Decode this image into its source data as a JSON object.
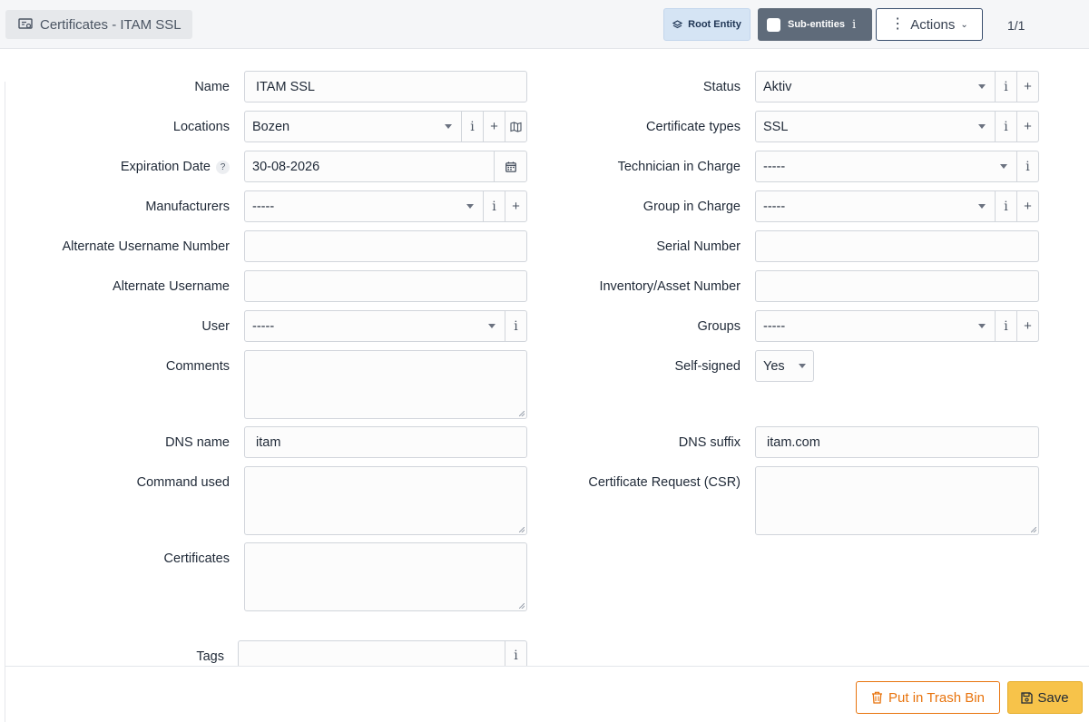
{
  "header": {
    "title": "Certificates - ITAM SSL",
    "root_entity_label": "Root Entity",
    "sub_entities_label": "Sub-entities",
    "actions_label": "Actions",
    "pager": "1/1"
  },
  "form": {
    "name": {
      "label": "Name",
      "value": "ITAM SSL"
    },
    "locations": {
      "label": "Locations",
      "value": "Bozen"
    },
    "expiration_date": {
      "label": "Expiration Date",
      "value": "30-08-2026",
      "help": "?"
    },
    "manufacturers": {
      "label": "Manufacturers",
      "value": "-----"
    },
    "alt_username_number": {
      "label": "Alternate Username Number",
      "value": ""
    },
    "alt_username": {
      "label": "Alternate Username",
      "value": ""
    },
    "user": {
      "label": "User",
      "value": "-----"
    },
    "comments": {
      "label": "Comments",
      "value": ""
    },
    "dns_name": {
      "label": "DNS name",
      "value": "itam"
    },
    "command_used": {
      "label": "Command used",
      "value": ""
    },
    "certificates": {
      "label": "Certificates",
      "value": ""
    },
    "tags": {
      "label": "Tags",
      "value": ""
    },
    "status": {
      "label": "Status",
      "value": "Aktiv"
    },
    "certificate_types": {
      "label": "Certificate types",
      "value": "SSL"
    },
    "technician": {
      "label": "Technician in Charge",
      "value": "-----"
    },
    "group_in_charge": {
      "label": "Group in Charge",
      "value": "-----"
    },
    "serial_number": {
      "label": "Serial Number",
      "value": ""
    },
    "inventory_number": {
      "label": "Inventory/Asset Number",
      "value": ""
    },
    "groups": {
      "label": "Groups",
      "value": "-----"
    },
    "self_signed": {
      "label": "Self-signed",
      "value": "Yes"
    },
    "dns_suffix": {
      "label": "DNS suffix",
      "value": "itam.com"
    },
    "csr": {
      "label": "Certificate Request (CSR)",
      "value": ""
    }
  },
  "addons": {
    "info": "i",
    "add": "+"
  },
  "footer": {
    "trash_label": "Put in Trash Bin",
    "save_label": "Save"
  },
  "colors": {
    "accent_orange": "#e8740e",
    "save_yellow": "#f7c34a",
    "root_entity_bg": "#d5e4f4",
    "sub_entities_bg": "#5f6b7a"
  }
}
